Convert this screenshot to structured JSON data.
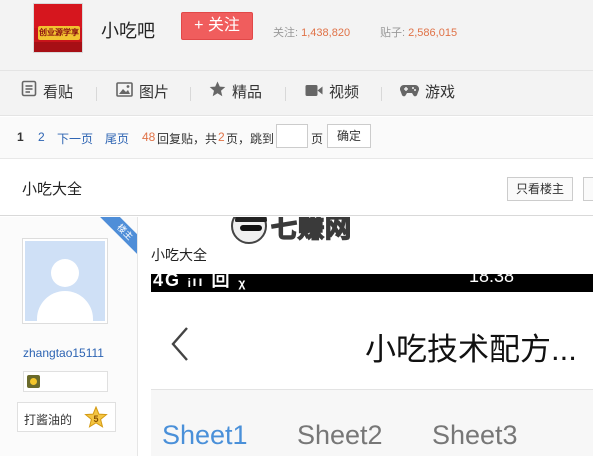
{
  "forum": {
    "logo_text": "创业源学享",
    "name": "小吃吧",
    "follow_label": "+ 关注",
    "follow_label_prefix": "关注:",
    "follow_count": "1,438,820",
    "posts_label_prefix": "贴子:",
    "posts_count": "2,586,015"
  },
  "tabs": [
    {
      "label": "看贴",
      "icon": "post-list-icon"
    },
    {
      "label": "图片",
      "icon": "picture-icon"
    },
    {
      "label": "精品",
      "icon": "star-icon"
    },
    {
      "label": "视频",
      "icon": "video-icon"
    },
    {
      "label": "游戏",
      "icon": "gamepad-icon"
    }
  ],
  "pager": {
    "current": "1",
    "page2": "2",
    "next": "下一页",
    "last": "尾页",
    "reply_count": "48",
    "reply_text": "回复贴，共",
    "total_pages": "2",
    "pages_text": "页，跳到",
    "page_unit": "页",
    "go_label": "确定"
  },
  "thread": {
    "title": "小吃大全",
    "only_op_label": "只看楼主"
  },
  "author": {
    "op_badge": "楼主",
    "username": "zhangtao15111",
    "level_name": "打酱油的",
    "level": "5"
  },
  "post": {
    "watermark": "七赚网",
    "title": "小吃大全",
    "status_left": "4G ᵢₗₗ 回 ᵪ",
    "status_time": "18:38",
    "doc_title": "小吃技术配方...",
    "sheets": [
      "Sheet1",
      "Sheet2",
      "Sheet3"
    ],
    "active_sheet": "Sheet1"
  },
  "colors": {
    "follow_button": "#f05d5d",
    "link": "#2d64b3",
    "stat_number": "#e07247",
    "op_ribbon": "#4f8ed8",
    "active_sheet": "#4a90d9"
  }
}
